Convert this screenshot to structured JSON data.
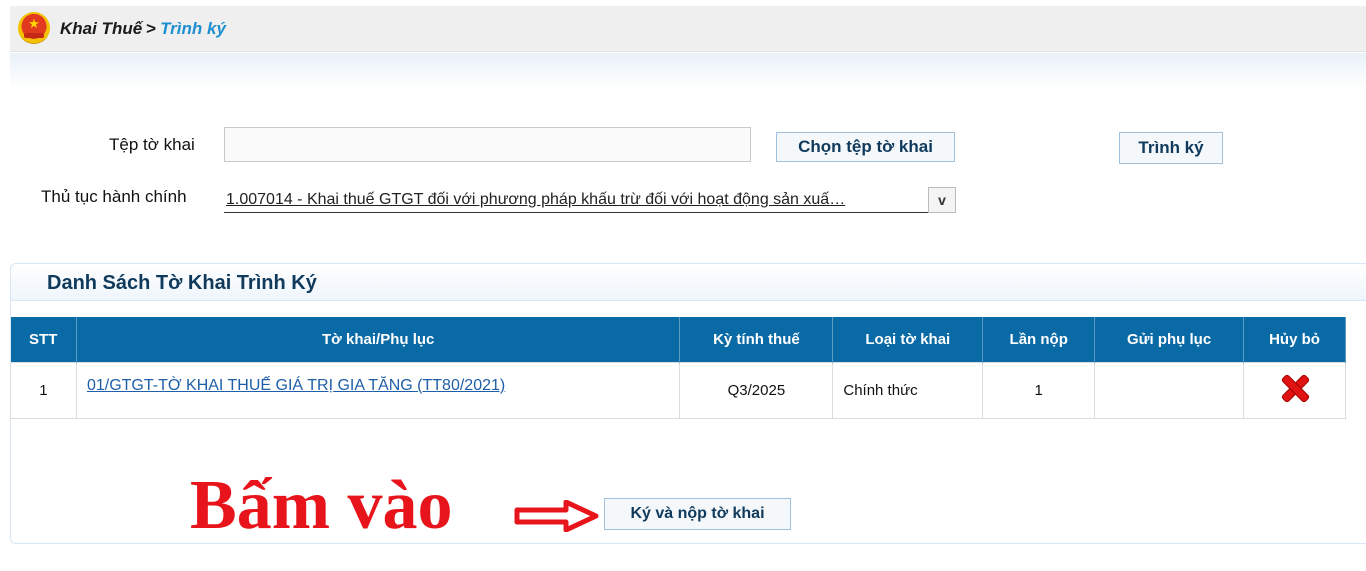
{
  "breadcrumb": {
    "root": "Khai Thuế",
    "separator": ">",
    "current": "Trình ký"
  },
  "form": {
    "file_label": "Tệp tờ khai",
    "file_value": "",
    "choose_button": "Chọn tệp tờ khai",
    "sign_button": "Trình ký",
    "procedure_label": "Thủ tục hành chính",
    "procedure_selected": "1.007014 - Khai thuế GTGT đối với phương pháp khấu trừ đối với hoạt động sản xuấ…",
    "procedure_arrow": "v"
  },
  "panel": {
    "title": "Danh Sách Tờ Khai Trình Ký",
    "columns": [
      "STT",
      "Tờ khai/Phụ lục",
      "Kỳ tính thuế",
      "Loại tờ khai",
      "Lần nộp",
      "Gửi phụ lục",
      "Hủy bỏ"
    ],
    "rows": [
      {
        "stt": "1",
        "form": "01/GTGT-TỜ KHAI THUẾ GIÁ TRỊ GIA TĂNG (TT80/2021)",
        "period": "Q3/2025",
        "type": "Chính thức",
        "times": "1",
        "attach": "",
        "cancel_icon": "red-x-icon"
      }
    ]
  },
  "annotation": {
    "text": "Bấm vào",
    "color": "#e8141b"
  },
  "submit_button": "Ký và nộp tờ khai",
  "colors": {
    "table_header": "#0a6aa6",
    "link": "#1f5ea8",
    "breadcrumb_current": "#1e8fd0",
    "title": "#0f3a5c"
  }
}
